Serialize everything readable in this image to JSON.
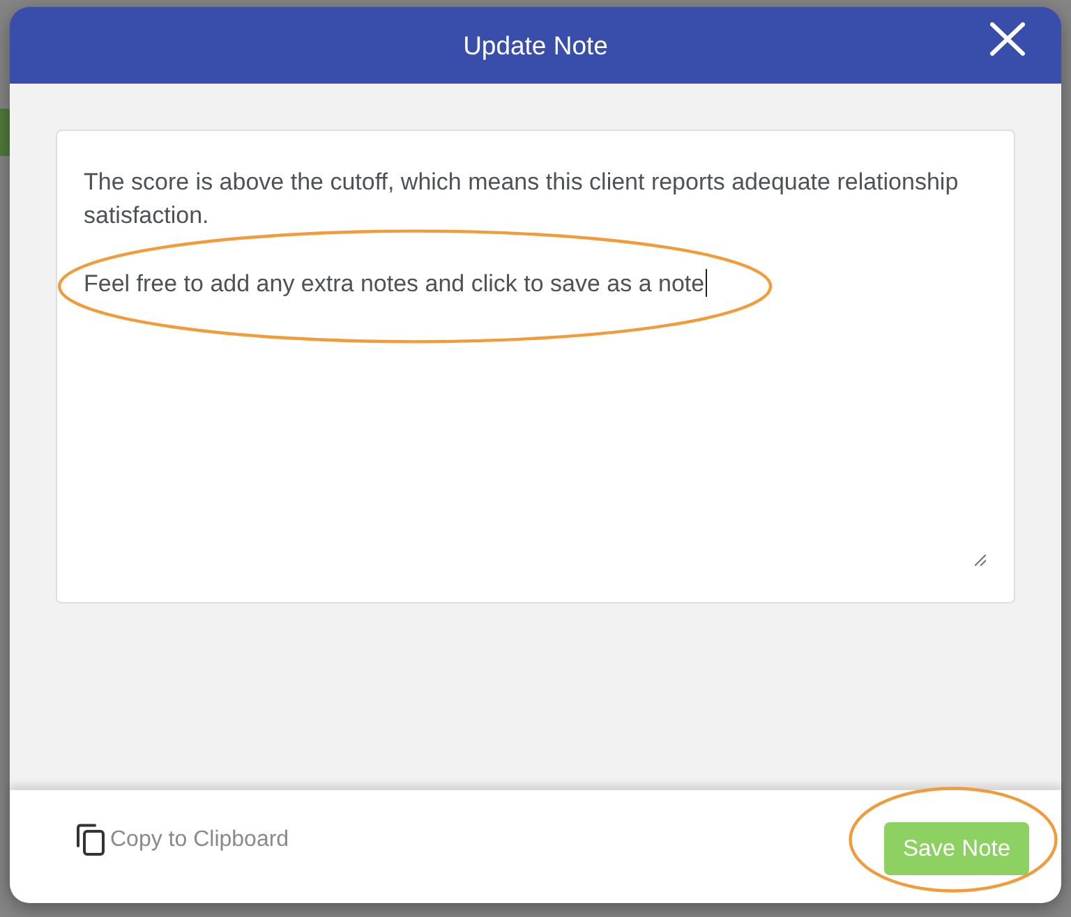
{
  "dialog": {
    "title": "Update Note"
  },
  "note": {
    "focused": true,
    "paragraphs": [
      {
        "text": "The score is above the cutoff, which means this client reports adequate relationship satisfaction.",
        "highlighted": false
      },
      {
        "text": "Feel free to add any extra notes and click to save as a note",
        "highlighted": true
      }
    ]
  },
  "footer": {
    "copy_button": {
      "label": "Copy to Clipboard",
      "highlighted": false
    },
    "save_button": {
      "label": "Save Note",
      "highlighted": true
    }
  }
}
